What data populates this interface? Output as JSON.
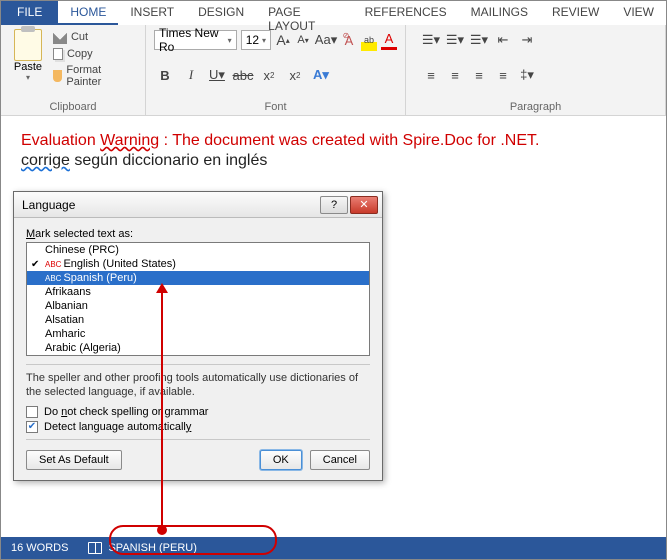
{
  "tabs": {
    "file": "FILE",
    "home": "HOME",
    "insert": "INSERT",
    "design": "DESIGN",
    "page_layout": "PAGE LAYOUT",
    "references": "REFERENCES",
    "mailings": "MAILINGS",
    "review": "REVIEW",
    "view": "VIEW"
  },
  "ribbon": {
    "clipboard": {
      "label": "Clipboard",
      "paste": "Paste",
      "cut": "Cut",
      "copy": "Copy",
      "format_painter": "Format Painter"
    },
    "font": {
      "label": "Font",
      "family": "Times New Ro",
      "size": "12",
      "grow": "A",
      "shrink": "A",
      "case": "Aa",
      "clear": "A"
    },
    "paragraph": {
      "label": "Paragraph"
    }
  },
  "document": {
    "warning_prefix": "Evaluation ",
    "warning_word": "Warning",
    "warning_suffix": " : The document was created with Spire.Doc for .NET.",
    "line2_a": "corrige",
    "line2_b": " según diccionario en inglés"
  },
  "dialog": {
    "title": "Language",
    "mark_label_pre": "",
    "mark_label_u": "M",
    "mark_label_post": "ark selected text as:",
    "items": [
      "Chinese (PRC)",
      "English (United States)",
      "Spanish (Peru)",
      "Afrikaans",
      "Albanian",
      "Alsatian",
      "Amharic",
      "Arabic (Algeria)"
    ],
    "selected_index": 2,
    "checked_index": 1,
    "desc": "The speller and other proofing tools automatically use dictionaries of the selected language, if available.",
    "opt1_pre": "Do ",
    "opt1_u": "n",
    "opt1_post": "ot check spelling or grammar",
    "opt2_pre": "Detect language automaticall",
    "opt2_u": "y",
    "set_default": "Set As Default",
    "ok": "OK",
    "cancel": "Cancel"
  },
  "status": {
    "words": "16 WORDS",
    "language": "SPANISH (PERU)"
  }
}
